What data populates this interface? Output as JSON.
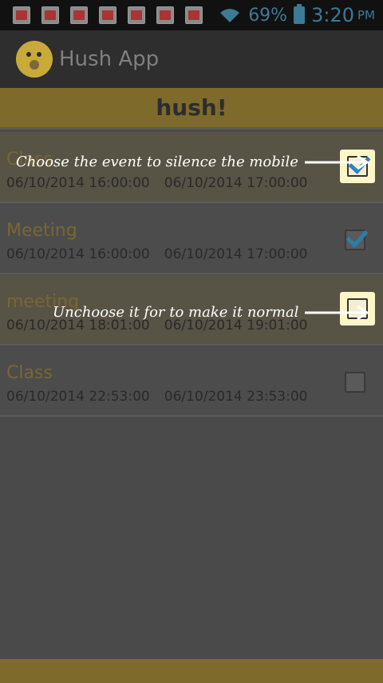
{
  "status_bar": {
    "notification_count": 7,
    "battery_percent": "69%",
    "time": "3:20",
    "ampm": "PM"
  },
  "action_bar": {
    "title": "Hush App"
  },
  "brand": {
    "text": "hush!"
  },
  "events": [
    {
      "name": "Class",
      "start": "06/10/2014 16:00:00",
      "end": "06/10/2014 17:00:00",
      "checked": true
    },
    {
      "name": "Meeting",
      "start": "06/10/2014 16:00:00",
      "end": "06/10/2014 17:00:00",
      "checked": true
    },
    {
      "name": "meeting",
      "start": "06/10/2014 18:01:00",
      "end": "06/10/2014 19:01:00",
      "checked": false
    },
    {
      "name": "Class",
      "start": "06/10/2014 22:53:00",
      "end": "06/10/2014 23:53:00",
      "checked": false
    }
  ],
  "hints": {
    "choose": "Choose the event to silence the mobile",
    "unchoose": "Unchoose it for to make it normal"
  },
  "colors": {
    "accent": "#7e6a2b",
    "check_blue": "#2b7dab",
    "status_text": "#3c7a96"
  }
}
